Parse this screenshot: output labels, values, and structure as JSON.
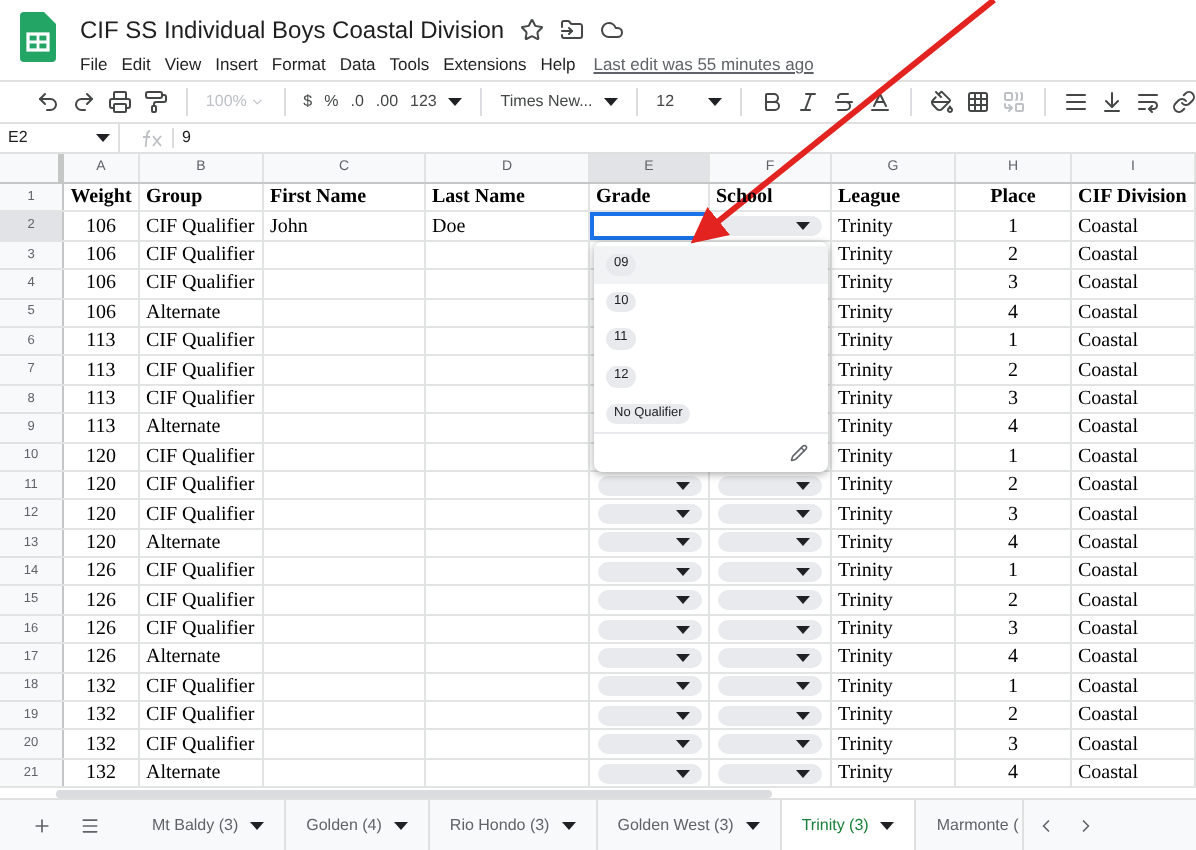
{
  "document": {
    "title": "CIF SS Individual Boys Coastal Division",
    "last_edit": "Last edit was 55 minutes ago"
  },
  "menu": [
    "File",
    "Edit",
    "View",
    "Insert",
    "Format",
    "Data",
    "Tools",
    "Extensions",
    "Help"
  ],
  "toolbar": {
    "zoom": "100%",
    "zoom_disabled": true,
    "currency": "$",
    "percent": "%",
    "decrease_decimals": ".0",
    "increase_decimals": ".00",
    "number_format": "123",
    "font": "Times New...",
    "font_size": "12"
  },
  "formula_bar": {
    "cell": "E2",
    "value": "9"
  },
  "columns": [
    {
      "letter": "A",
      "selected": false
    },
    {
      "letter": "B",
      "selected": false
    },
    {
      "letter": "C",
      "selected": false
    },
    {
      "letter": "D",
      "selected": false
    },
    {
      "letter": "E",
      "selected": true
    },
    {
      "letter": "F",
      "selected": false
    },
    {
      "letter": "G",
      "selected": false
    },
    {
      "letter": "H",
      "selected": false
    },
    {
      "letter": "I",
      "selected": false
    }
  ],
  "header_row": {
    "number": "1",
    "cells": [
      "Weight",
      "Group",
      "First Name",
      "Last Name",
      "Grade",
      "School",
      "League",
      "Place",
      "CIF Division"
    ]
  },
  "rows": [
    {
      "number": "2",
      "weight": "106",
      "group": "CIF Qualifier",
      "first_name": "John",
      "last_name": "Doe",
      "league": "Trinity",
      "place": "1",
      "division": "Coastal",
      "selected": true
    },
    {
      "number": "3",
      "weight": "106",
      "group": "CIF Qualifier",
      "league": "Trinity",
      "place": "2",
      "division": "Coastal",
      "selected": false
    },
    {
      "number": "4",
      "weight": "106",
      "group": "CIF Qualifier",
      "league": "Trinity",
      "place": "3",
      "division": "Coastal",
      "selected": false
    },
    {
      "number": "5",
      "weight": "106",
      "group": "Alternate",
      "league": "Trinity",
      "place": "4",
      "division": "Coastal",
      "selected": false
    },
    {
      "number": "6",
      "weight": "113",
      "group": "CIF Qualifier",
      "league": "Trinity",
      "place": "1",
      "division": "Coastal",
      "selected": false
    },
    {
      "number": "7",
      "weight": "113",
      "group": "CIF Qualifier",
      "league": "Trinity",
      "place": "2",
      "division": "Coastal",
      "selected": false
    },
    {
      "number": "8",
      "weight": "113",
      "group": "CIF Qualifier",
      "league": "Trinity",
      "place": "3",
      "division": "Coastal",
      "selected": false
    },
    {
      "number": "9",
      "weight": "113",
      "group": "Alternate",
      "league": "Trinity",
      "place": "4",
      "division": "Coastal",
      "selected": false
    },
    {
      "number": "10",
      "weight": "120",
      "group": "CIF Qualifier",
      "league": "Trinity",
      "place": "1",
      "division": "Coastal",
      "selected": false
    },
    {
      "number": "11",
      "weight": "120",
      "group": "CIF Qualifier",
      "league": "Trinity",
      "place": "2",
      "division": "Coastal",
      "selected": false
    },
    {
      "number": "12",
      "weight": "120",
      "group": "CIF Qualifier",
      "league": "Trinity",
      "place": "3",
      "division": "Coastal",
      "selected": false
    },
    {
      "number": "13",
      "weight": "120",
      "group": "Alternate",
      "league": "Trinity",
      "place": "4",
      "division": "Coastal",
      "selected": false
    },
    {
      "number": "14",
      "weight": "126",
      "group": "CIF Qualifier",
      "league": "Trinity",
      "place": "1",
      "division": "Coastal",
      "selected": false
    },
    {
      "number": "15",
      "weight": "126",
      "group": "CIF Qualifier",
      "league": "Trinity",
      "place": "2",
      "division": "Coastal",
      "selected": false
    },
    {
      "number": "16",
      "weight": "126",
      "group": "CIF Qualifier",
      "league": "Trinity",
      "place": "3",
      "division": "Coastal",
      "selected": false
    },
    {
      "number": "17",
      "weight": "126",
      "group": "Alternate",
      "league": "Trinity",
      "place": "4",
      "division": "Coastal",
      "selected": false
    },
    {
      "number": "18",
      "weight": "132",
      "group": "CIF Qualifier",
      "league": "Trinity",
      "place": "1",
      "division": "Coastal",
      "selected": false
    },
    {
      "number": "19",
      "weight": "132",
      "group": "CIF Qualifier",
      "league": "Trinity",
      "place": "2",
      "division": "Coastal",
      "selected": false
    },
    {
      "number": "20",
      "weight": "132",
      "group": "CIF Qualifier",
      "league": "Trinity",
      "place": "3",
      "division": "Coastal",
      "selected": false
    },
    {
      "number": "21",
      "weight": "132",
      "group": "Alternate",
      "league": "Trinity",
      "place": "4",
      "division": "Coastal",
      "selected": false
    }
  ],
  "dropdown": {
    "options": [
      {
        "label": "09",
        "selected": true
      },
      {
        "label": "10",
        "selected": false
      },
      {
        "label": "11",
        "selected": false
      },
      {
        "label": "12",
        "selected": false
      },
      {
        "label": "No Qualifier",
        "selected": false
      }
    ]
  },
  "sheet_tabs": [
    {
      "label": "Mt Baldy (3)",
      "selected": false
    },
    {
      "label": "Golden (4)",
      "selected": false
    },
    {
      "label": "Rio Hondo (3)",
      "selected": false
    },
    {
      "label": "Golden West (3)",
      "selected": false
    },
    {
      "label": "Trinity (3)",
      "selected": true
    },
    {
      "label": "Marmonte (",
      "selected": false
    }
  ]
}
